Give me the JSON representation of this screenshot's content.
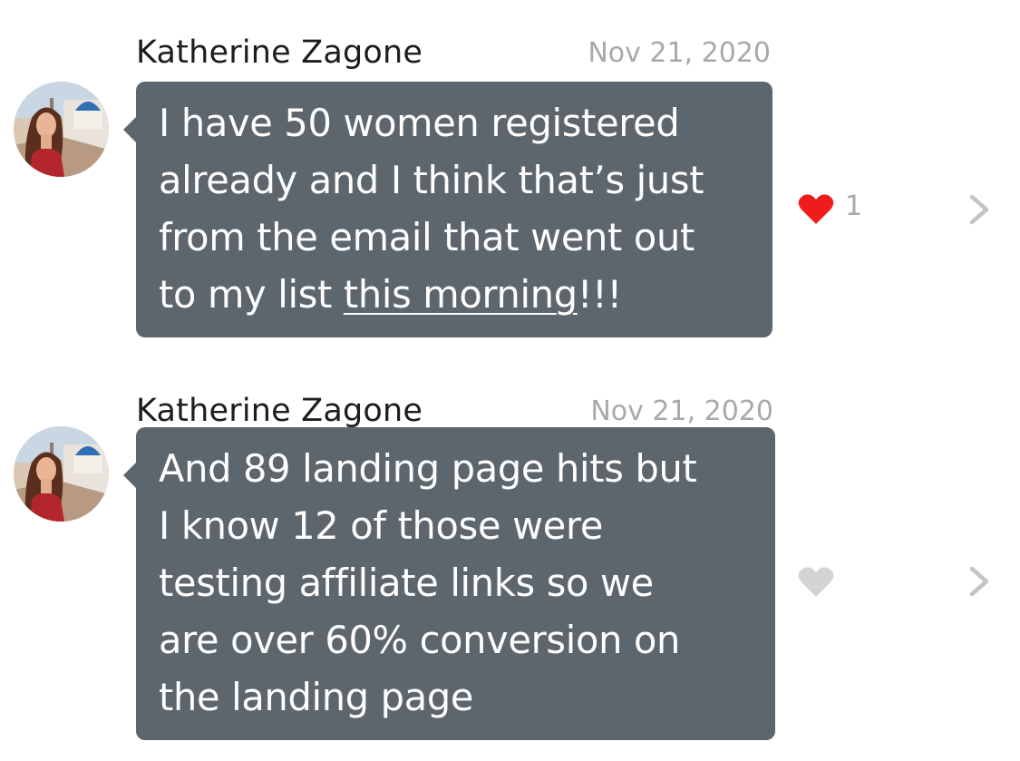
{
  "messages": [
    {
      "sender": "Katherine Zagone",
      "timestamp": "Nov 21, 2020",
      "lines": [
        "I have 50 women registered",
        "already and I think that’s just",
        "from the email that went out"
      ],
      "last_line_prefix": "to my list ",
      "last_line_link": "this morning",
      "last_line_suffix": "!!!",
      "liked": true,
      "like_count": "1",
      "like_color": "#ef1c1c",
      "avatar_icon": "profile-photo"
    },
    {
      "sender": "Katherine Zagone",
      "timestamp": "Nov 21, 2020",
      "lines": [
        "And 89 landing page hits but",
        "I know 12 of those were",
        "testing affiliate links so we",
        "are over 60% conversion on",
        "the landing page"
      ],
      "liked": false,
      "like_count": "",
      "like_color": "#d3d3d3",
      "avatar_icon": "profile-photo"
    }
  ],
  "colors": {
    "bubble": "#5d666d",
    "bubble_text": "#ffffff",
    "sender_text": "#1d1d1d",
    "meta_text": "#a9a9a9",
    "chevron": "#c4c4c4"
  },
  "icons": {
    "like": "heart-icon",
    "open": "chevron-right-icon"
  }
}
